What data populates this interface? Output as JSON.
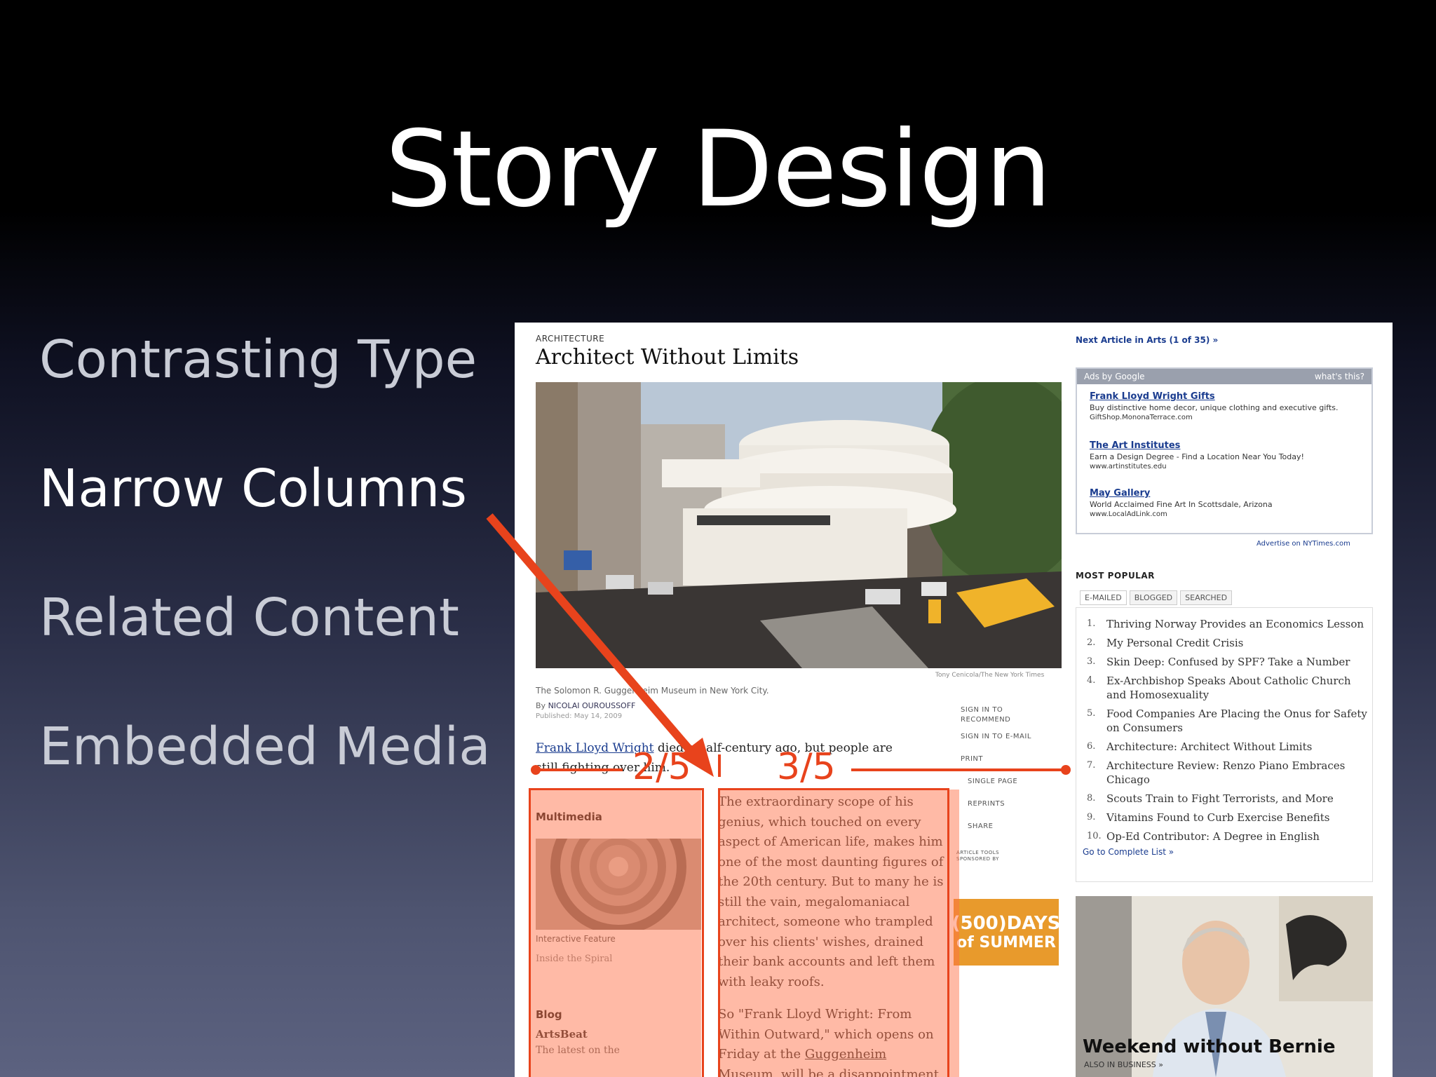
{
  "slide": {
    "title": "Story Design",
    "bullets": [
      {
        "label": "Contrasting Type"
      },
      {
        "label": "Narrow Columns"
      },
      {
        "label": "Related Content"
      },
      {
        "label": "Embedded Media"
      }
    ]
  },
  "article": {
    "kicker": "ARCHITECTURE",
    "headline": "Architect Without Limits",
    "photo_credit": "Tony Cenicola/The New York Times",
    "caption": "The Solomon R. Guggenheim Museum in New York City.",
    "byline_prefix": "By",
    "byline_author": "NICOLAI OUROUSSOFF",
    "published": "Published: May 14, 2009",
    "lede_link": "Frank Lloyd Wright",
    "lede_rest": " died a half-century ago, but people are still fighting over him.",
    "body_p1": "The extraordinary scope of his genius, which touched on every aspect of American life, makes him one of the most daunting figures of the 20th century. But to many he is still the vain, megalomaniacal architect, someone who trampled over his clients' wishes, drained their bank accounts and left them with leaky roofs.",
    "body_p2_a": "So \"Frank Lloyd Wright: From Within Outward,\" which opens on Friday at the ",
    "body_p2_link": "Guggenheim Museum",
    "body_p2_b": ", will be a disappointment to some. The show offers no new insight",
    "tools": [
      "SIGN IN TO RECOMMEND",
      "SIGN IN TO E-MAIL",
      "PRINT",
      "SINGLE PAGE",
      "REPRINTS",
      "SHARE"
    ],
    "tools_sponsor": "ARTICLE TOOLS SPONSORED BY",
    "ad_line1": "(500)DAYS",
    "ad_line2": "of SUMMER",
    "multimedia_head": "Multimedia",
    "multimedia_label": "Interactive Feature",
    "multimedia_sub": "Inside the Spiral",
    "blog_head": "Blog",
    "blog_name": "ArtsBeat",
    "blog_sub": "The latest on the"
  },
  "sidebar": {
    "next_article": "Next Article in Arts (1 of 35) »",
    "ads_label": "Ads by Google",
    "ads_whats": "what's this?",
    "ads": [
      {
        "title": "Frank Lloyd Wright Gifts",
        "desc": "Buy distinctive home decor, unique clothing and executive gifts.",
        "url": "GiftShop.MononaTerrace.com"
      },
      {
        "title": "The Art Institutes",
        "desc": "Earn a Design Degree - Find a Location Near You Today!",
        "url": "www.artinstitutes.edu"
      },
      {
        "title": "May Gallery",
        "desc": "World Acclaimed Fine Art In Scottsdale, Arizona",
        "url": "www.LocalAdLink.com"
      }
    ],
    "advertise": "Advertise on NYTimes.com",
    "most_popular": "MOST POPULAR",
    "tabs": [
      "E-MAILED",
      "BLOGGED",
      "SEARCHED"
    ],
    "popular": [
      {
        "num": "1.",
        "text": "Thriving Norway Provides an Economics Lesson"
      },
      {
        "num": "2.",
        "text": "My Personal Credit Crisis"
      },
      {
        "num": "3.",
        "text": "Skin Deep: Confused by SPF? Take a Number"
      },
      {
        "num": "4.",
        "text": "Ex-Archbishop Speaks About Catholic Church and Homosexuality"
      },
      {
        "num": "5.",
        "text": "Food Companies Are Placing the Onus for Safety on Consumers"
      },
      {
        "num": "6.",
        "text": "Architecture: Architect Without Limits"
      },
      {
        "num": "7.",
        "text": "Architecture Review: Renzo Piano Embraces Chicago"
      },
      {
        "num": "8.",
        "text": "Scouts Train to Fight Terrorists, and More"
      },
      {
        "num": "9.",
        "text": "Vitamins Found to Curb Exercise Benefits"
      },
      {
        "num": "10.",
        "text": "Op-Ed Contributor: A Degree in English"
      }
    ],
    "go_complete": "Go to Complete List »",
    "promo_title": "Weekend without Bernie",
    "promo_sub": "ALSO IN BUSINESS »"
  },
  "annotation": {
    "left_ratio": "2/5",
    "right_ratio": "3/5",
    "color": "#e8431c"
  }
}
